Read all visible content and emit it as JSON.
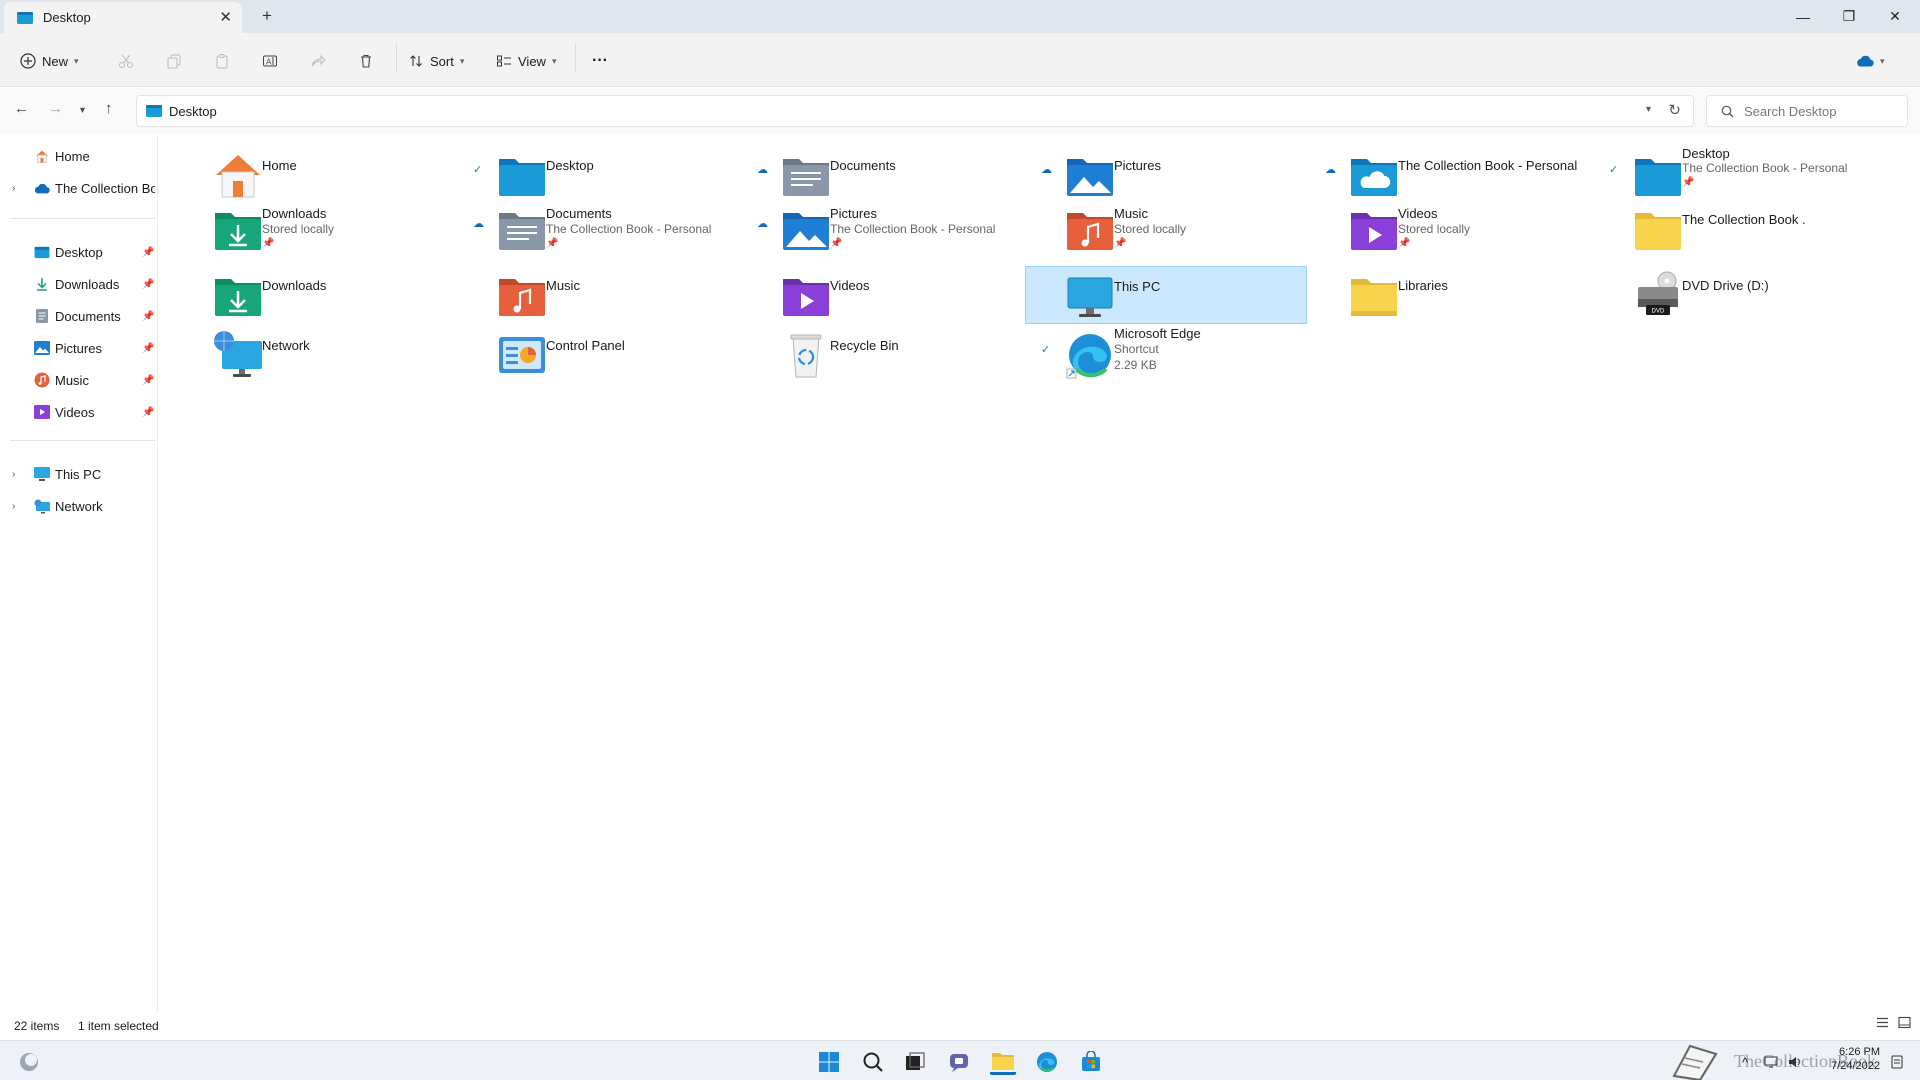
{
  "window": {
    "tab_title": "Desktop",
    "tab_close": "✕",
    "new_tab": "+",
    "minimize": "—",
    "maximize": "❐",
    "close": "✕"
  },
  "toolbar": {
    "new_label": "New",
    "sort_label": "Sort",
    "view_label": "View",
    "more_label": "···"
  },
  "address": {
    "path": "Desktop",
    "search_placeholder": "Search Desktop"
  },
  "sidebar": {
    "home": "Home",
    "onedrive": "The Collection Boo",
    "quick": [
      {
        "label": "Desktop"
      },
      {
        "label": "Downloads"
      },
      {
        "label": "Documents"
      },
      {
        "label": "Pictures"
      },
      {
        "label": "Music"
      },
      {
        "label": "Videos"
      }
    ],
    "this_pc": "This PC",
    "network": "Network"
  },
  "items": [
    {
      "name": "Home"
    },
    {
      "name": "Desktop"
    },
    {
      "name": "Documents"
    },
    {
      "name": "Pictures"
    },
    {
      "name": "The Collection Book - Personal"
    },
    {
      "name": "Desktop",
      "sub": "The Collection Book - Personal"
    },
    {
      "name": "Downloads",
      "sub": "Stored locally"
    },
    {
      "name": "Documents",
      "sub": "The Collection Book - Personal"
    },
    {
      "name": "Pictures",
      "sub": "The Collection Book - Personal"
    },
    {
      "name": "Music",
      "sub": "Stored locally"
    },
    {
      "name": "Videos",
      "sub": "Stored locally"
    },
    {
      "name": "The Collection Book ."
    },
    {
      "name": "Downloads"
    },
    {
      "name": "Music"
    },
    {
      "name": "Videos"
    },
    {
      "name": "This PC"
    },
    {
      "name": "Libraries"
    },
    {
      "name": "DVD Drive (D:)"
    },
    {
      "name": "Network"
    },
    {
      "name": "Control Panel"
    },
    {
      "name": "Recycle Bin"
    },
    {
      "name": "Microsoft Edge",
      "sub": "Shortcut",
      "sub2": "2.29 KB"
    }
  ],
  "status": {
    "count": "22 items",
    "selected": "1 item selected"
  },
  "taskbar": {
    "time": "6:26 PM",
    "date": "7/24/2022",
    "watermark": "TheCollectionBook"
  },
  "colors": {
    "accent": "#0f6cbd",
    "selection": "#cce8ff",
    "folder_yellow": "#f8d44c"
  }
}
